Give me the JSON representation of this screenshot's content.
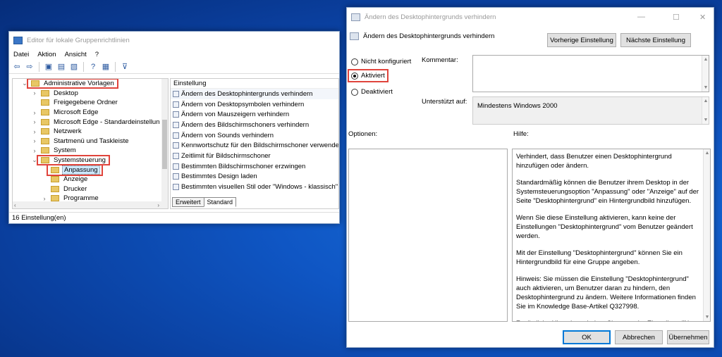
{
  "gpe": {
    "title": "Editor für lokale Gruppenrichtlinien",
    "menu": [
      "Datei",
      "Aktion",
      "Ansicht",
      "?"
    ],
    "tree": [
      {
        "label": "Administrative Vorlagen",
        "indent": 0,
        "chevron": "⌄",
        "highlight": true
      },
      {
        "label": "Desktop",
        "indent": 1,
        "chevron": "›"
      },
      {
        "label": "Freigegebene Ordner",
        "indent": 1,
        "chevron": ""
      },
      {
        "label": "Microsoft Edge",
        "indent": 1,
        "chevron": "›"
      },
      {
        "label": "Microsoft Edge - Standardeinstellun",
        "indent": 1,
        "chevron": "›"
      },
      {
        "label": "Netzwerk",
        "indent": 1,
        "chevron": "›"
      },
      {
        "label": "Startmenü und Taskleiste",
        "indent": 1,
        "chevron": "›"
      },
      {
        "label": "System",
        "indent": 1,
        "chevron": "›"
      },
      {
        "label": "Systemsteuerung",
        "indent": 1,
        "chevron": "⌄",
        "highlight": true
      },
      {
        "label": "Anpassung",
        "indent": 2,
        "chevron": "",
        "highlight": true,
        "selected": true
      },
      {
        "label": "Anzeige",
        "indent": 2,
        "chevron": ""
      },
      {
        "label": "Drucker",
        "indent": 2,
        "chevron": ""
      },
      {
        "label": "Programme",
        "indent": 2,
        "chevron": "›"
      }
    ],
    "list_header": "Einstellung",
    "settings": [
      "Ändern des Desktophintergrunds verhindern",
      "Ändern von Desktopsymbolen verhindern",
      "Ändern von Mauszeigern verhindern",
      "Ändern des Bildschirmschoners verhindern",
      "Ändern von Sounds verhindern",
      "Kennwortschutz für den Bildschirmschoner verwenden",
      "Zeitlimit für Bildschirmschoner",
      "Bestimmten Bildschirmschoner erzwingen",
      "Bestimmtes Design laden",
      "Bestimmten visuellen Stil oder \"Windows - klassisch\" erzwi"
    ],
    "tabs": [
      "Erweitert",
      "Standard"
    ],
    "status": "16 Einstellung(en)"
  },
  "dialog": {
    "title": "Ändern des Desktophintergrunds verhindern",
    "heading": "Ändern des Desktophintergrunds verhindern",
    "prev_button": "Vorherige Einstellung",
    "next_button": "Nächste Einstellung",
    "radio_not_configured": "Nicht konfiguriert",
    "radio_enabled": "Aktiviert",
    "radio_disabled": "Deaktiviert",
    "comment_label": "Kommentar:",
    "supported_label": "Unterstützt auf:",
    "supported_value": "Mindestens Windows 2000",
    "options_label": "Optionen:",
    "help_label": "Hilfe:",
    "help": [
      "Verhindert, dass Benutzer einen Desktophintergrund hinzufügen oder ändern.",
      "Standardmäßig können die Benutzer ihrem Desktop in der Systemsteuerungsoption \"Anpassung\" oder \"Anzeige\" auf der Seite \"Desktophintergrund\" ein Hintergrundbild hinzufügen.",
      "Wenn Sie diese Einstellung aktivieren, kann keine der Einstellungen \"Desktophintergrund\" vom Benutzer geändert werden.",
      "Mit der Einstellung \"Desktophintergrund\" können Sie ein Hintergrundbild für eine Gruppe angeben.",
      "Hinweis: Sie müssen die Einstellung \"Desktophintergrund\" auch aktivieren, um Benutzer daran zu hindern, den Desktophintergrund zu ändern. Weitere Informationen finden Sie im Knowledge Base-Artikel Q327998.",
      "Zusätzliche Hinweise erhalten Sie unter der Einstellung \"Nur"
    ],
    "ok": "OK",
    "cancel": "Abbrechen",
    "apply": "Übernehmen"
  }
}
